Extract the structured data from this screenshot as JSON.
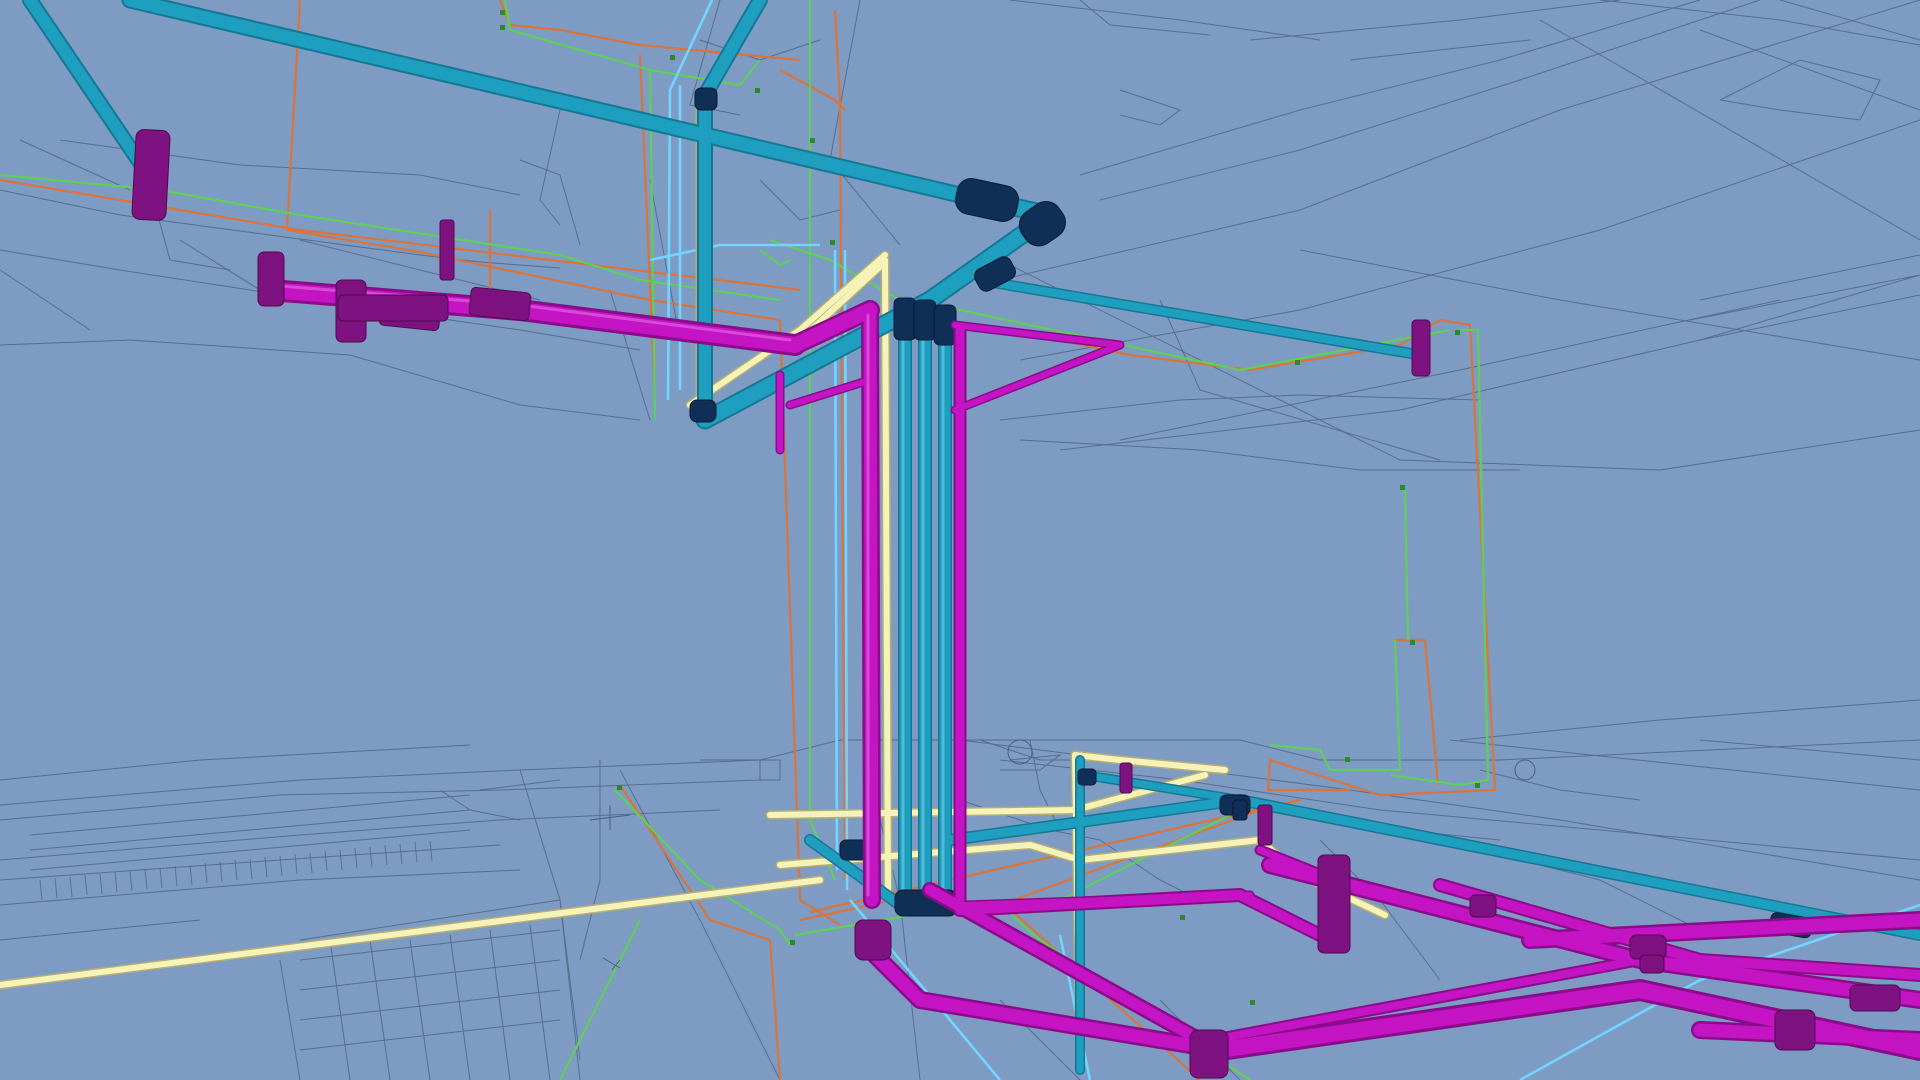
{
  "viewport": {
    "background": "#7d9bc3",
    "view": "3d-perspective-bim-model"
  },
  "colors": {
    "background": "#7d9bc3",
    "floor_plan_lines": "#4b5f7d",
    "magenta_pipe": "#c414c4",
    "magenta_pipe_shade": "#8a0c8a",
    "magenta_fitting": "#7e1280",
    "cyan_pipe": "#1e9fc0",
    "cyan_pipe_shade": "#147894",
    "cyan_fitting": "#0f2f57",
    "cream_pipe": "#f6f3b8",
    "light_blue_line": "#72d4ff",
    "orange_line": "#d8743c",
    "green_line": "#5fcf59"
  },
  "layers": {
    "floor_plan": "architectural-floor-plan-lines",
    "magenta_pipes": "magenta-pipe-system",
    "cyan_pipes": "cyan-pipe-system",
    "cream_pipes": "cream-pipe-system",
    "thin_lines": "thin-line-systems"
  }
}
